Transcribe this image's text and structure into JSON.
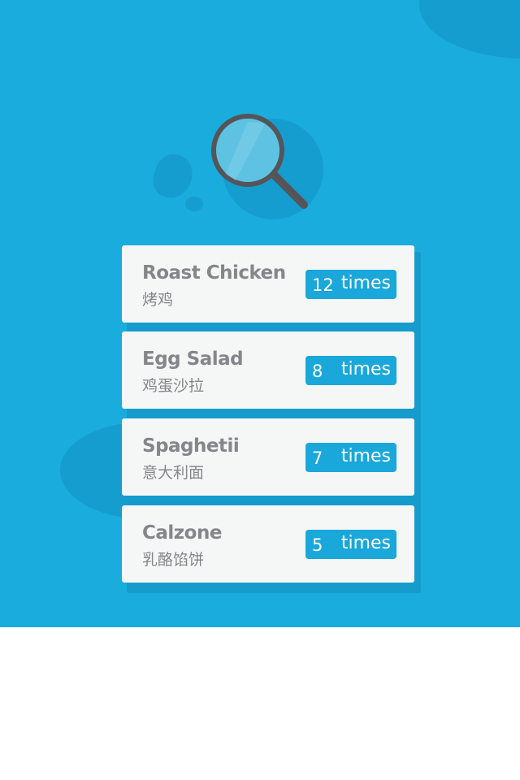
{
  "colors": {
    "background": "#1aacdc",
    "blob": "#159dcf",
    "card": "#f5f7f7",
    "card_text": "#86868a",
    "badge": "#1aa7da",
    "badge_text": "#ffffff",
    "lens_frame": "#555559",
    "lens_glass": "#5ec3e3"
  },
  "header": {
    "icon": "search-icon"
  },
  "results": [
    {
      "name_en": "Roast Chicken",
      "name_zh": "烤鸡",
      "count": "12",
      "unit": "times"
    },
    {
      "name_en": "Egg Salad",
      "name_zh": "鸡蛋沙拉",
      "count": "8",
      "unit": "times"
    },
    {
      "name_en": "Spaghetii",
      "name_zh": "意大利面",
      "count": "7",
      "unit": "times"
    },
    {
      "name_en": "Calzone",
      "name_zh": "乳酪馅饼",
      "count": "5",
      "unit": "times"
    }
  ]
}
